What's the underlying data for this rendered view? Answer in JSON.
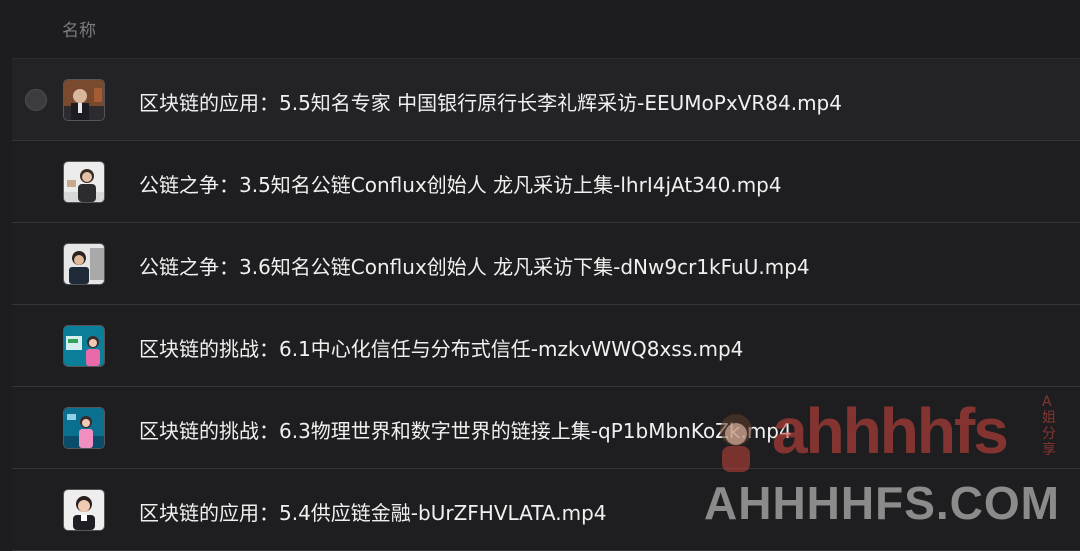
{
  "header": {
    "name_column": "名称"
  },
  "files": [
    {
      "name": "区块链的应用：5.5知名专家 中国银行原行长李礼辉采访-EEUMoPxVR84.mp4",
      "selected": false
    },
    {
      "name": "公链之争：3.5知名公链Conflux创始人 龙凡采访上集-lhrI4jAt340.mp4"
    },
    {
      "name": "公链之争：3.6知名公链Conflux创始人 龙凡采访下集-dNw9cr1kFuU.mp4"
    },
    {
      "name": "区块链的挑战：6.1中心化信任与分布式信任-mzkvWWQ8xss.mp4"
    },
    {
      "name": "区块链的挑战：6.3物理世界和数字世界的链接上集-qP1bMbnKoZk.mp4"
    },
    {
      "name": "区块链的应用：5.4供应链金融-bUrZFHVLATA.mp4"
    }
  ],
  "watermark": {
    "logo_text": "ahhhhfs",
    "logo_sub": "A姐分享",
    "site": "AHHHHFS.COM"
  }
}
